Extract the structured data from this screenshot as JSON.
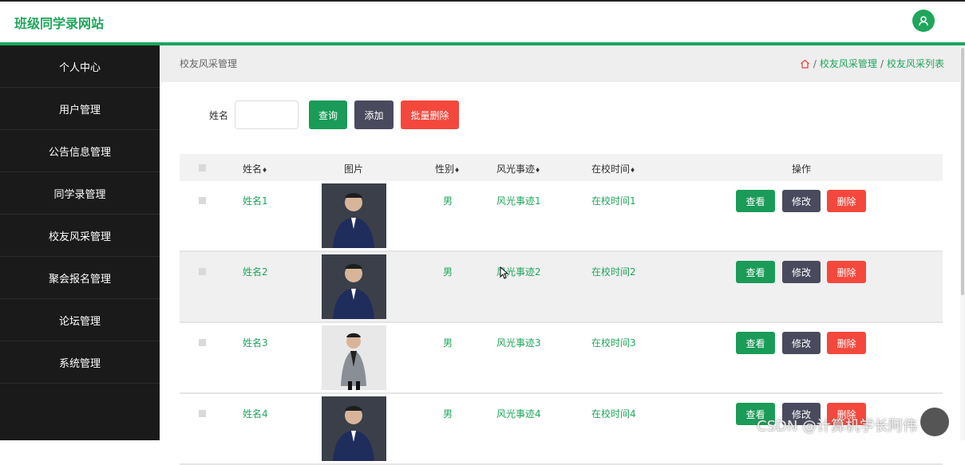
{
  "header": {
    "site_title": "班级同学录网站"
  },
  "sidebar": {
    "items": [
      "个人中心",
      "用户管理",
      "公告信息管理",
      "同学录管理",
      "校友风采管理",
      "聚会报名管理",
      "论坛管理",
      "系统管理"
    ]
  },
  "breadcrumb": {
    "page_title": "校友风采管理",
    "crumb1": "校友风采管理",
    "crumb2": "校友风采列表",
    "sep": "/"
  },
  "search": {
    "label": "姓名",
    "value": "",
    "query_label": "查询",
    "add_label": "添加",
    "bulk_delete_label": "批量删除"
  },
  "table": {
    "headers": {
      "name": "姓名",
      "image": "图片",
      "gender": "性别",
      "deeds": "风光事迹",
      "school_time": "在校时间",
      "actions": "操作"
    },
    "sort_glyph": "♦",
    "action_labels": {
      "view": "查看",
      "edit": "修改",
      "delete": "删除"
    },
    "rows": [
      {
        "name": "姓名1",
        "gender": "男",
        "deeds": "风光事迹1",
        "school_time": "在校时间1"
      },
      {
        "name": "姓名2",
        "gender": "男",
        "deeds": "风光事迹2",
        "school_time": "在校时间2"
      },
      {
        "name": "姓名3",
        "gender": "男",
        "deeds": "风光事迹3",
        "school_time": "在校时间3"
      },
      {
        "name": "姓名4",
        "gender": "男",
        "deeds": "风光事迹4",
        "school_time": "在校时间4"
      }
    ]
  },
  "watermark": "CSDN @计算机学长阿伟",
  "colors": {
    "accent": "#1fa65c",
    "sidebar_bg": "#1a1a1a",
    "danger": "#f4483d",
    "dark_button": "#4a4a5e"
  }
}
